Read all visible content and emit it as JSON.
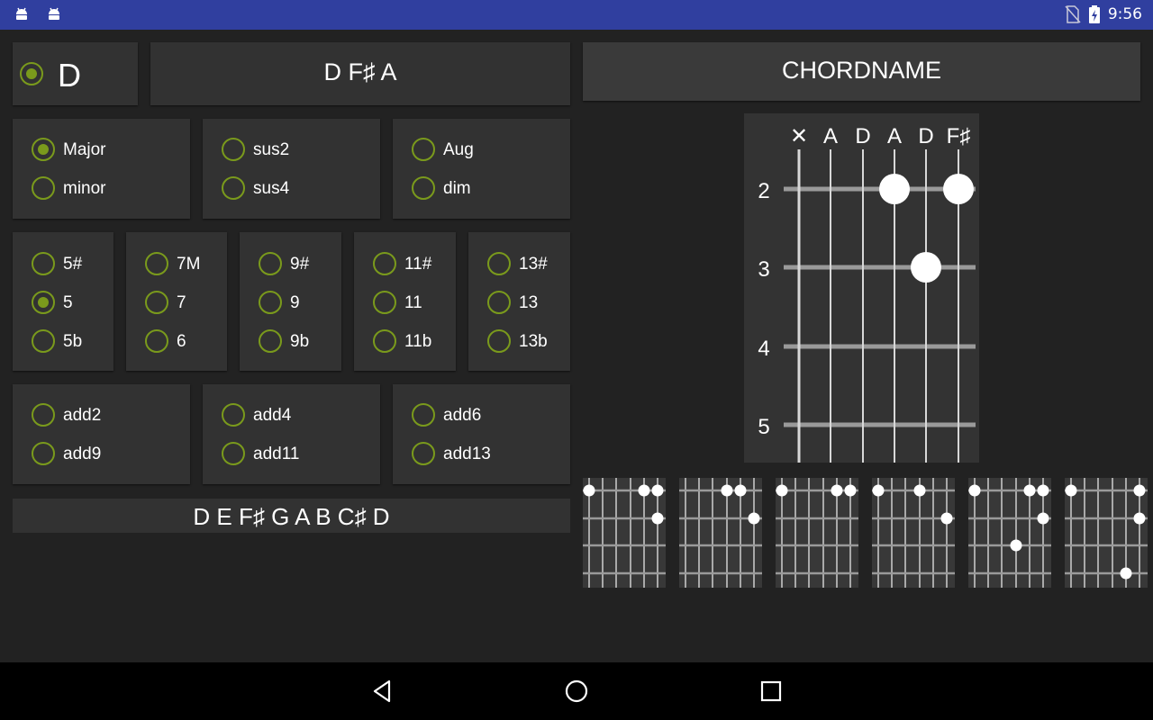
{
  "status_bar": {
    "time": "9:56",
    "left_icons": [
      "android-icon",
      "android-icon"
    ],
    "right_icons": [
      "no-sim-icon",
      "battery-charging-icon"
    ]
  },
  "root": {
    "note": "D",
    "selected": true
  },
  "notes_display": "D F♯ A",
  "chord_name_button": "CHORDNAME",
  "triad_options": [
    {
      "label": "Major",
      "checked": true
    },
    {
      "label": "minor",
      "checked": false
    },
    {
      "label": "sus2",
      "checked": false
    },
    {
      "label": "sus4",
      "checked": false
    },
    {
      "label": "Aug",
      "checked": false
    },
    {
      "label": "dim",
      "checked": false
    }
  ],
  "extension_groups": [
    {
      "options": [
        {
          "label": "5#",
          "checked": false
        },
        {
          "label": "5",
          "checked": true
        },
        {
          "label": "5b",
          "checked": false
        }
      ]
    },
    {
      "options": [
        {
          "label": "7M",
          "checked": false
        },
        {
          "label": "7",
          "checked": false
        },
        {
          "label": "6",
          "checked": false
        }
      ]
    },
    {
      "options": [
        {
          "label": "9#",
          "checked": false
        },
        {
          "label": "9",
          "checked": false
        },
        {
          "label": "9b",
          "checked": false
        }
      ]
    },
    {
      "options": [
        {
          "label": "11#",
          "checked": false
        },
        {
          "label": "11",
          "checked": false
        },
        {
          "label": "11b",
          "checked": false
        }
      ]
    },
    {
      "options": [
        {
          "label": "13#",
          "checked": false
        },
        {
          "label": "13",
          "checked": false
        },
        {
          "label": "13b",
          "checked": false
        }
      ]
    }
  ],
  "add_options": [
    {
      "label": "add2",
      "checked": false
    },
    {
      "label": "add9",
      "checked": false
    },
    {
      "label": "add4",
      "checked": false
    },
    {
      "label": "add11",
      "checked": false
    },
    {
      "label": "add6",
      "checked": false
    },
    {
      "label": "add13",
      "checked": false
    }
  ],
  "scale_display": "D E F♯ G A B C♯ D",
  "fretboard": {
    "string_labels": [
      "✕",
      "A",
      "D",
      "A",
      "D",
      "F♯"
    ],
    "fret_numbers": [
      "2",
      "3",
      "4",
      "5"
    ],
    "dots": [
      {
        "string": 3,
        "fret": 0
      },
      {
        "string": 5,
        "fret": 0
      },
      {
        "string": 4,
        "fret": 1
      }
    ]
  },
  "chord_variations": [
    {
      "dots": [
        {
          "string": 0,
          "fret": 0
        },
        {
          "string": 2,
          "fret": 0
        },
        {
          "string": 3,
          "fret": 0
        },
        {
          "string": 2,
          "fret": 1
        }
      ]
    },
    {
      "dots": [
        {
          "string": 1,
          "fret": 0
        },
        {
          "string": 3,
          "fret": 0
        },
        {
          "string": 2,
          "fret": 1
        }
      ]
    },
    {
      "dots": [
        {
          "string": 0,
          "fret": 0
        },
        {
          "string": 2,
          "fret": 0
        },
        {
          "string": 3,
          "fret": 0
        }
      ]
    },
    {
      "dots": [
        {
          "string": 0,
          "fret": 0
        },
        {
          "string": 1,
          "fret": 0
        },
        {
          "string": 2,
          "fret": 1
        }
      ]
    },
    {
      "dots": [
        {
          "string": 0,
          "fret": 0
        },
        {
          "string": 2,
          "fret": 0
        },
        {
          "string": 3,
          "fret": 0
        },
        {
          "string": 2,
          "fret": 1
        },
        {
          "string": 1,
          "fret": 2
        }
      ]
    },
    {
      "dots": [
        {
          "string": 0,
          "fret": 0
        },
        {
          "string": 2,
          "fret": 0
        },
        {
          "string": 2,
          "fret": 1
        },
        {
          "string": 3,
          "fret": 3
        }
      ]
    }
  ],
  "colors": {
    "accent": "#7a9a1c",
    "status_bar": "#303f9f",
    "panel": "#323232",
    "background": "#222222"
  },
  "nav": {
    "back": "back-icon",
    "home": "home-icon",
    "recents": "recents-icon"
  }
}
